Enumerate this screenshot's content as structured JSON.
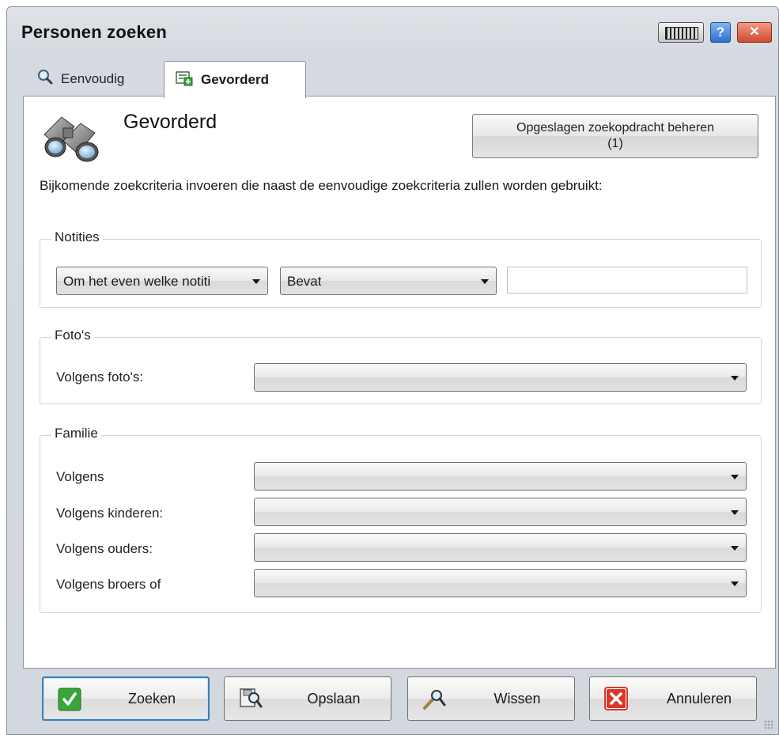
{
  "window": {
    "title": "Personen zoeken",
    "help_label": "?",
    "close_label": "✕"
  },
  "tabs": [
    {
      "label": "Eenvoudig",
      "icon": "magnifier-icon",
      "active": false
    },
    {
      "label": "Gevorderd",
      "icon": "advanced-search-icon",
      "active": true
    }
  ],
  "header": {
    "title": "Gevorderd",
    "icon": "binoculars-icon",
    "saved_searches_button_line1": "Opgeslagen zoekopdracht beheren",
    "saved_searches_button_line2": "(1)",
    "description": "Bijkomende zoekcriteria invoeren die naast de eenvoudige zoekcriteria zullen worden gebruikt:"
  },
  "notes": {
    "legend": "Notities",
    "note_type_value": "Om het even welke notiti",
    "operator_value": "Bevat",
    "text_value": ""
  },
  "photos": {
    "legend": "Foto's",
    "by_photos_label": "Volgens foto's:",
    "by_photos_value": ""
  },
  "family": {
    "legend": "Familie",
    "rows": [
      {
        "label": "Volgens",
        "value": ""
      },
      {
        "label": "Volgens kinderen:",
        "value": ""
      },
      {
        "label": "Volgens ouders:",
        "value": ""
      },
      {
        "label": "Volgens broers of",
        "value": ""
      }
    ]
  },
  "buttons": {
    "search_label": "Zoeken",
    "save_label": "Opslaan",
    "clear_label": "Wissen",
    "cancel_label": "Annuleren"
  },
  "colors": {
    "title_bar": "#d5dae0",
    "focus_border": "#3c7fb1",
    "check_green": "#3aa53a",
    "cancel_red": "#d83a2a"
  }
}
